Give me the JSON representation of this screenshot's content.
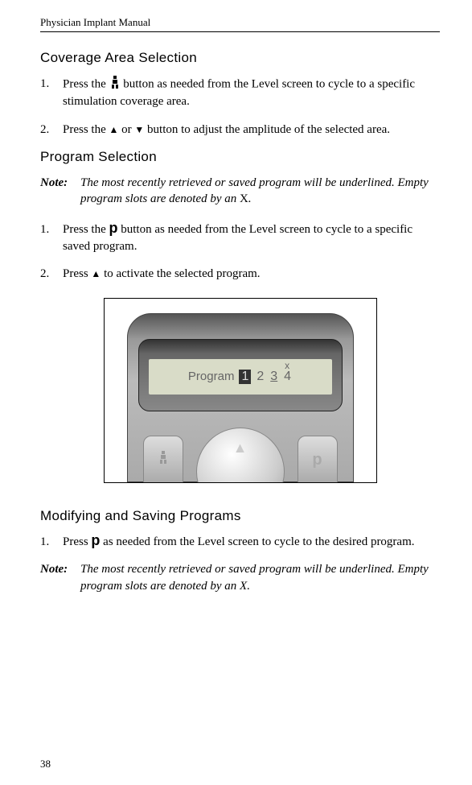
{
  "header": {
    "title": "Physician Implant Manual"
  },
  "section1": {
    "heading": "Coverage Area Selection",
    "item1_num": "1.",
    "item1_text_a": "Press the ",
    "item1_text_b": "  button as needed from the Level screen to cycle to a specific stimulation coverage area.",
    "item2_num": "2.",
    "item2_text_a": "Press the ",
    "item2_text_b": " or ",
    "item2_text_c": " button to adjust the amplitude of the selected area."
  },
  "section2": {
    "heading": "Program Selection",
    "note_label": "Note:",
    "note_text_a": "The most recently retrieved or saved program will be underlined. Empty program slots are denoted by an ",
    "note_text_b": "X",
    "note_text_c": ".",
    "item1_num": "1.",
    "item1_text_a": "Press the ",
    "item1_text_b": " button as needed from the Level screen to cycle to a specific saved program.",
    "item2_num": "2.",
    "item2_text_a": "Press ",
    "item2_text_b": " to activate the selected program."
  },
  "device": {
    "screen_label": "Program",
    "num1": "1",
    "num2": "2",
    "num3": "3",
    "num4": "4",
    "super": "x",
    "btn_p": "p"
  },
  "section3": {
    "heading": "Modifying and Saving Programs",
    "item1_num": "1.",
    "item1_text_a": "Press ",
    "item1_text_b": " as needed from the Level screen to cycle to the desired program.",
    "note_label": "Note:",
    "note_text": "The most recently retrieved or saved program will be underlined. Empty program slots are denoted by an X."
  },
  "footer": {
    "page": "38"
  },
  "icons": {
    "area": "area-icon",
    "up_triangle": "▲",
    "down_triangle": "▼",
    "p_bold": "p"
  }
}
